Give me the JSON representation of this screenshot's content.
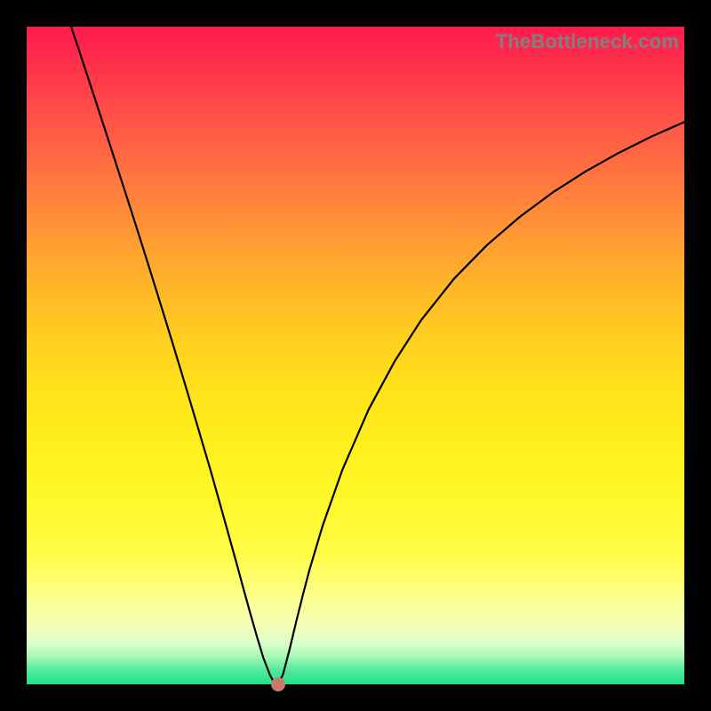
{
  "watermark": "TheBottleneck.com",
  "colors": {
    "background": "#000000",
    "gradient_top": "#ff1a4d",
    "gradient_bottom": "#1ee288",
    "curve": "#000000",
    "marker": "#c77b6a"
  },
  "chart_data": {
    "type": "line",
    "title": "",
    "xlabel": "",
    "ylabel": "",
    "xlim": [
      0,
      100
    ],
    "ylim": [
      0,
      100
    ],
    "grid": false,
    "series": [
      {
        "name": "bottleneck-curve",
        "x": [
          6.76,
          8,
          10,
          12,
          14,
          16,
          18,
          20,
          22,
          24,
          26,
          28,
          30,
          31,
          32,
          33,
          34,
          35,
          36,
          37,
          37.5,
          38.31,
          39,
          40,
          41,
          42,
          43,
          45,
          48,
          52,
          56,
          60,
          65,
          70,
          75,
          80,
          85,
          90,
          95,
          100
        ],
        "y": [
          100,
          96.3,
          90.2,
          84.1,
          77.9,
          71.7,
          65.4,
          59.0,
          52.5,
          45.9,
          39.2,
          32.4,
          25.3,
          21.7,
          18.1,
          14.4,
          10.8,
          7.3,
          4.0,
          1.4,
          0.5,
          0,
          1.6,
          5.4,
          9.6,
          13.6,
          17.4,
          24.1,
          32.6,
          41.8,
          49.2,
          55.4,
          61.7,
          66.8,
          71.1,
          74.8,
          78.0,
          80.8,
          83.3,
          85.5
        ]
      }
    ],
    "annotations": [
      {
        "name": "optimum-marker",
        "x": 38.31,
        "y": 0
      }
    ]
  }
}
